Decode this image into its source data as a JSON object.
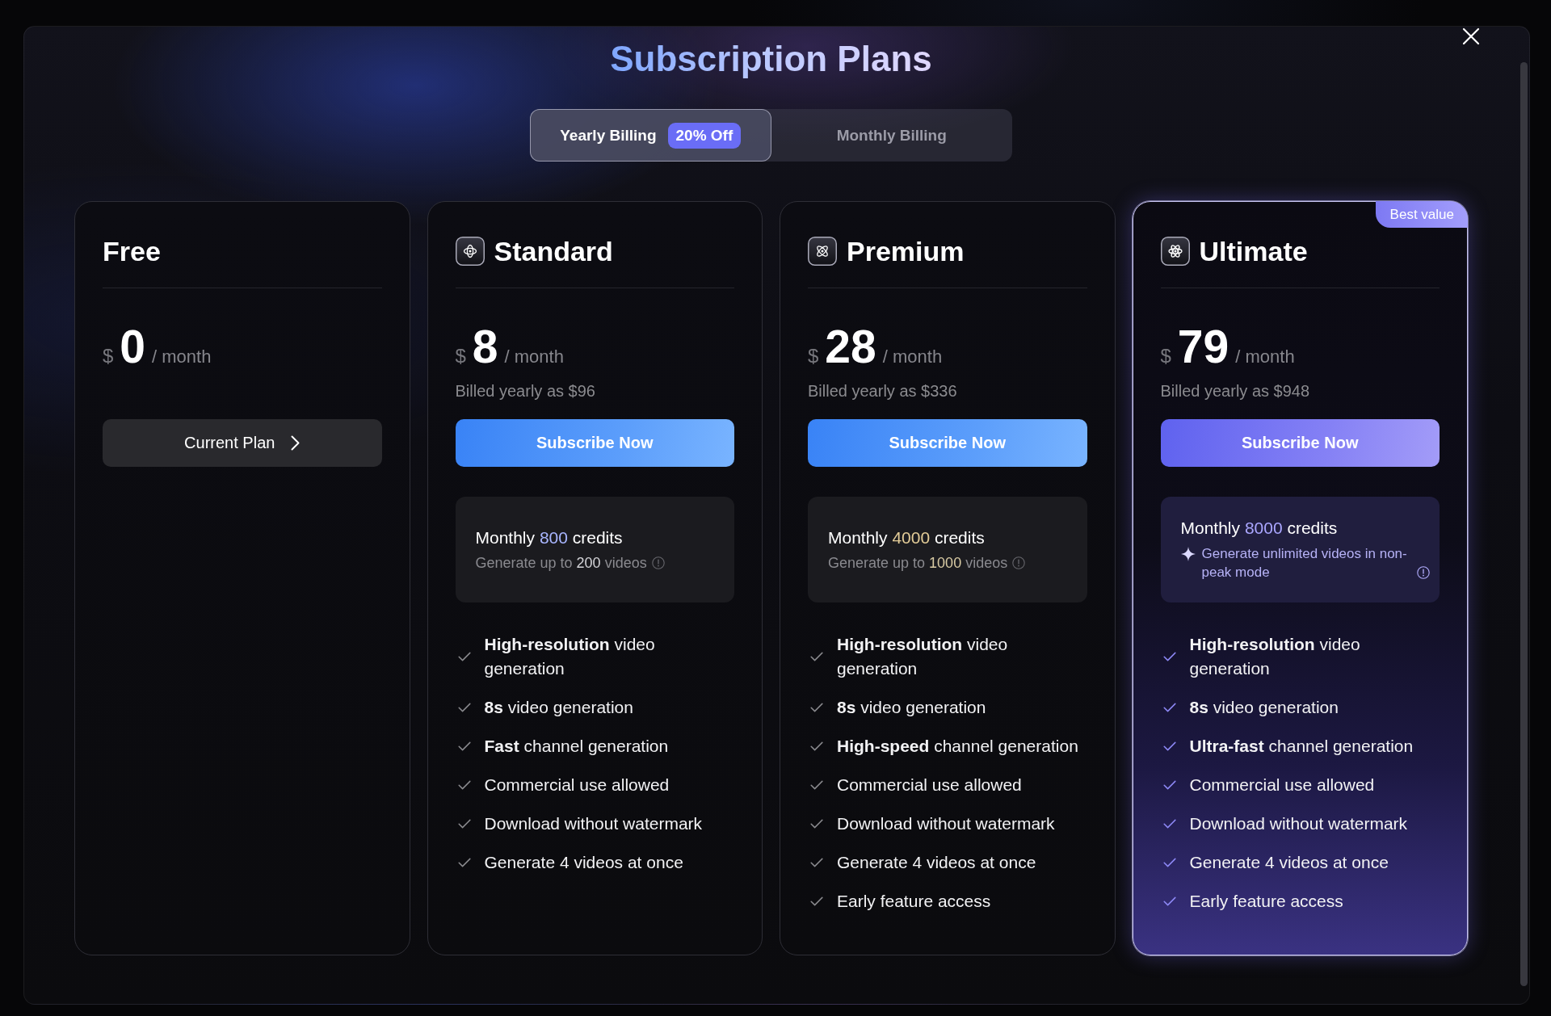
{
  "dialog": {
    "title": "Subscription Plans"
  },
  "billing_tabs": [
    {
      "label": "Yearly Billing",
      "badge": "20% Off",
      "selected": true
    },
    {
      "label": "Monthly Billing",
      "selected": false
    }
  ],
  "plans": [
    {
      "kind": "free",
      "name": "Free",
      "featured": false,
      "price": {
        "currency": "$",
        "amount": "0",
        "period": "/ month"
      },
      "button": {
        "kind": "current",
        "label": "Current Plan"
      }
    },
    {
      "kind": "standard",
      "name": "Standard",
      "featured": false,
      "price": {
        "currency": "$",
        "amount": "8",
        "period": "/ month"
      },
      "billed": "Billed yearly as $96",
      "button": {
        "kind": "subscribe",
        "label": "Subscribe Now"
      },
      "credits": {
        "prefix": "Monthly",
        "amount": "800",
        "suffix": "credits",
        "color": "#a9b6ff",
        "note": {
          "kind": "count",
          "prefix": "Generate up to",
          "amount": "200",
          "suffix": "videos",
          "color": "#d4d4d8"
        }
      },
      "features": [
        "**High-resolution** video generation",
        "**8s** video generation",
        "**Fast** channel generation",
        "Commercial use allowed",
        "Download without watermark",
        "Generate 4 videos at once"
      ]
    },
    {
      "kind": "premium",
      "name": "Premium",
      "featured": false,
      "price": {
        "currency": "$",
        "amount": "28",
        "period": "/ month"
      },
      "billed": "Billed yearly as $336",
      "button": {
        "kind": "subscribe",
        "label": "Subscribe Now"
      },
      "credits": {
        "prefix": "Monthly",
        "amount": "4000",
        "suffix": "credits",
        "color": "#e3cc98",
        "note": {
          "kind": "count",
          "prefix": "Generate up to",
          "amount": "1000",
          "suffix": "videos",
          "color": "#d9cba4"
        }
      },
      "features": [
        "**High-resolution** video generation",
        "**8s** video generation",
        "**High-speed** channel generation",
        "Commercial use allowed",
        "Download without watermark",
        "Generate 4 videos at once",
        "Early feature access"
      ]
    },
    {
      "kind": "ultimate",
      "name": "Ultimate",
      "featured": true,
      "badge": "Best value",
      "price": {
        "currency": "$",
        "amount": "79",
        "period": "/ month"
      },
      "billed": "Billed yearly as $948",
      "button": {
        "kind": "subscribe",
        "label": "Subscribe Now"
      },
      "credits": {
        "prefix": "Monthly",
        "amount": "8000",
        "suffix": "credits",
        "color": "#aaa6ff",
        "note": {
          "kind": "unlimited",
          "text": "Generate unlimited videos in non-peak mode"
        }
      },
      "features": [
        "**High-resolution** video generation",
        "**8s** video generation",
        "**Ultra-fast** channel generation",
        "Commercial use allowed",
        "Download without watermark",
        "Generate 4 videos at once",
        "Early feature access"
      ]
    }
  ]
}
